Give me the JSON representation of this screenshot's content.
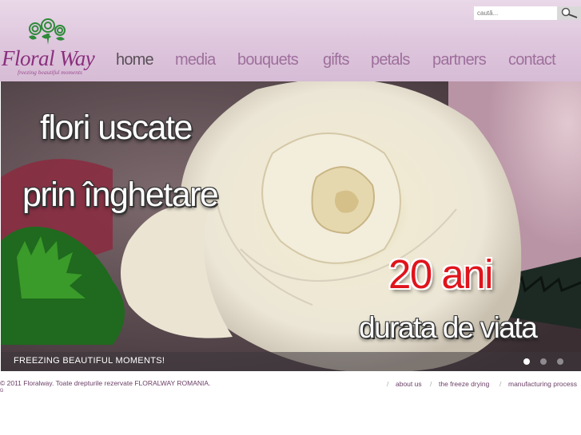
{
  "logo": {
    "name": "Floral Way",
    "tagline": "freezing beautiful moments"
  },
  "search": {
    "placeholder": "caută..."
  },
  "nav": {
    "items": [
      {
        "label": "home",
        "active": true
      },
      {
        "label": "media"
      },
      {
        "label": "bouquets"
      },
      {
        "label": "gifts"
      },
      {
        "label": "petals"
      },
      {
        "label": "partners"
      },
      {
        "label": "contact"
      }
    ]
  },
  "hero": {
    "line1": "flori uscate",
    "line2": "prin înghetare",
    "line3": "20 ani",
    "line4": "durata de viata",
    "caption": "FREEZING BEAUTIFUL MOMENTS!",
    "slides_total": 3,
    "active_slide": 1
  },
  "footer": {
    "copyright": "© 2011 Floralway. Toate drepturile rezervate FLORALWAY ROMANIA.",
    "mark": "ü",
    "links": [
      "about us",
      "the freeze drying",
      "manufacturing process"
    ],
    "separator": "/"
  },
  "colors": {
    "header_bg": "#e2cde1",
    "nav_text": "#9e6f9c",
    "nav_active": "#5a4f58",
    "brand": "#8a2f7e",
    "accent_red": "#e0141c"
  }
}
